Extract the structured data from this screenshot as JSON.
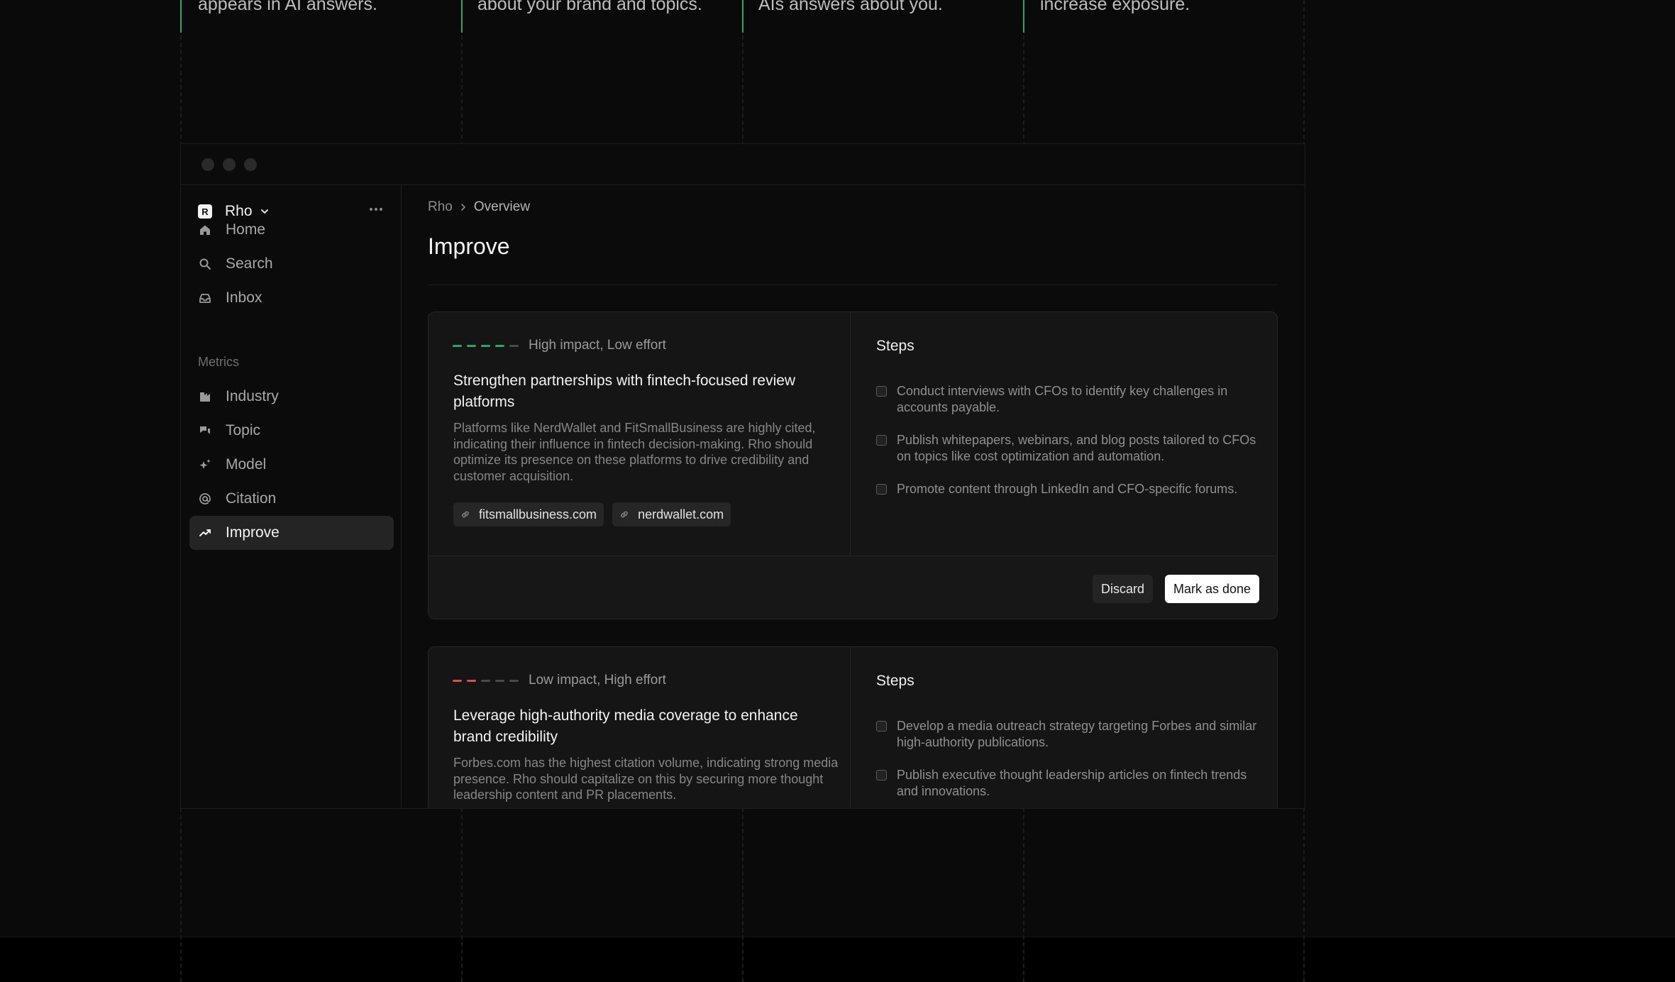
{
  "features": [
    {
      "text": "appears in AI answers."
    },
    {
      "text": "about your brand and topics."
    },
    {
      "text": "AIs answers about you."
    },
    {
      "text": "increase exposure."
    }
  ],
  "sidebar": {
    "workspace": {
      "logo_letter": "R",
      "name": "Rho"
    },
    "primary_items": [
      {
        "label": "Home",
        "icon": "home-icon"
      },
      {
        "label": "Search",
        "icon": "search-icon"
      },
      {
        "label": "Inbox",
        "icon": "inbox-icon"
      }
    ],
    "section_label": "Metrics",
    "metric_items": [
      {
        "label": "Industry",
        "icon": "industry-icon"
      },
      {
        "label": "Topic",
        "icon": "topic-icon"
      },
      {
        "label": "Model",
        "icon": "sparkle-icon"
      },
      {
        "label": "Citation",
        "icon": "at-icon"
      },
      {
        "label": "Improve",
        "icon": "trend-up-icon",
        "active": true
      }
    ]
  },
  "main": {
    "breadcrumb": {
      "root": "Rho",
      "current": "Overview"
    },
    "title": "Improve",
    "cards": [
      {
        "impact_level": 4,
        "impact_color": "#2ea36a",
        "impact_label": "High impact, Low effort",
        "title": "Strengthen partnerships with fintech-focused review platforms",
        "description": "Platforms like NerdWallet and FitSmallBusiness are highly cited, indicating their influence in fintech decision-making. Rho should optimize its presence on these platforms to drive credibility and customer acquisition.",
        "tags": [
          "fitsmallbusiness.com",
          "nerdwallet.com"
        ],
        "steps_title": "Steps",
        "steps": [
          "Conduct interviews with CFOs to identify key challenges in accounts payable.",
          "Publish whitepapers, webinars, and blog posts tailored to CFOs on topics like cost optimization and automation.",
          "Promote content through LinkedIn and CFO-specific forums."
        ],
        "discard_label": "Discard",
        "done_label": "Mark as done"
      },
      {
        "impact_level": 2,
        "impact_color": "#e5484d",
        "impact_label": "Low impact, High effort",
        "title": "Leverage high-authority media coverage to enhance brand credibility",
        "description": "Forbes.com has the highest citation volume, indicating strong media presence. Rho should capitalize on this by securing more thought leadership content and PR placements.",
        "steps_title": "Steps",
        "steps": [
          "Develop a media outreach strategy targeting Forbes and similar high-authority publications.",
          "Publish executive thought leadership articles on fintech trends and innovations."
        ]
      }
    ]
  },
  "colors": {
    "accent_green": "#2ea36a",
    "accent_red": "#e5484d",
    "bar_inactive": "#4a4a4a"
  }
}
